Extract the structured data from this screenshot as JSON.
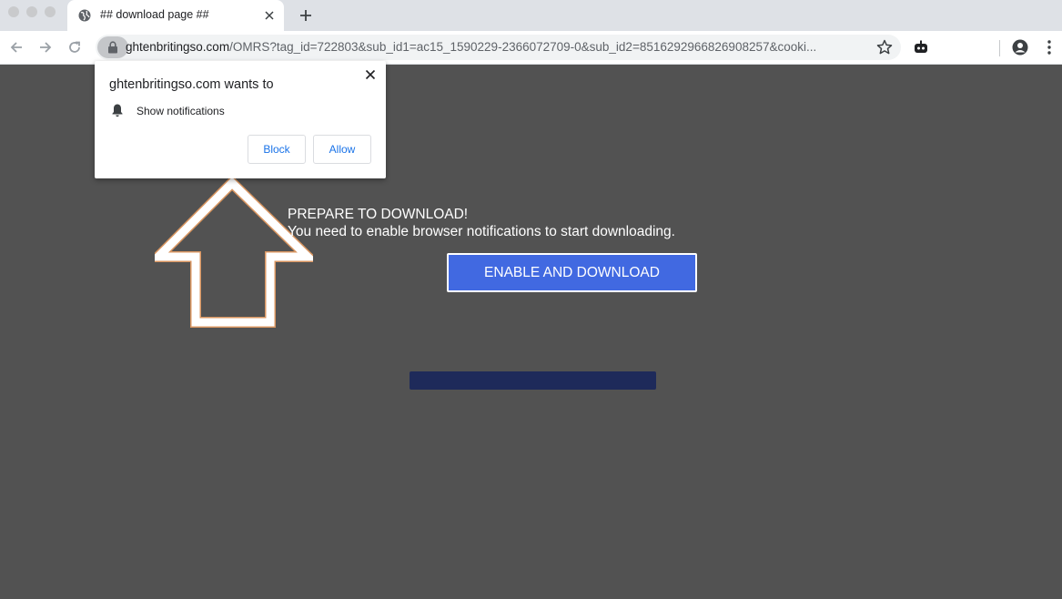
{
  "browser": {
    "tab": {
      "title": "## download page ##",
      "icon": "globe-icon"
    },
    "address_bar": {
      "host": "ghtenbritingso.com",
      "path": "/OMRS?tag_id=722803&sub_id1=ac15_1590229-2366072709-0&sub_id2=8516292966826908257&cooki..."
    }
  },
  "permission_popup": {
    "title": "ghtenbritingso.com wants to",
    "permission": "Show notifications",
    "block_label": "Block",
    "allow_label": "Allow"
  },
  "page": {
    "headline": "PREPARE TO DOWNLOAD!",
    "subline": "You need to enable browser notifications to start downloading.",
    "button_label": "ENABLE AND DOWNLOAD",
    "progress": 0
  },
  "colors": {
    "page_bg": "#525252",
    "button_bg": "#4169e1",
    "progress_track": "#1e2a5a",
    "link_blue": "#1a73e8"
  }
}
